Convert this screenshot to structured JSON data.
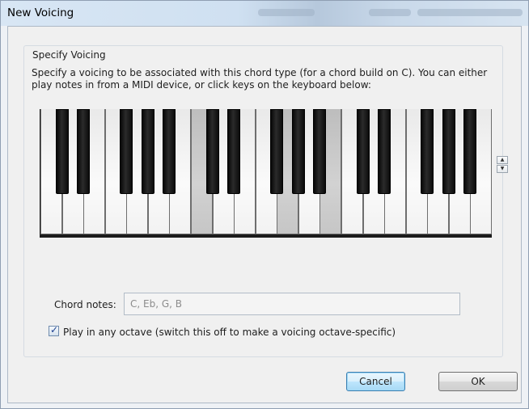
{
  "window": {
    "title": "New Voicing"
  },
  "group": {
    "label": "Specify Voicing",
    "description": "Specify a voicing to be associated with this chord type (for a chord build on C). You can either play notes in from a MIDI device, or click keys on the keyboard below:"
  },
  "keyboard": {
    "white_keys": 21,
    "selected_white_key_indices": [
      7,
      11,
      13
    ],
    "black_key_slots": [
      0,
      1,
      3,
      4,
      5,
      7,
      8,
      10,
      11,
      12,
      14,
      15,
      17,
      18,
      19
    ],
    "selected_black_key_slots": []
  },
  "chord_notes": {
    "label": "Chord notes:",
    "value": "C, Eb, G, B"
  },
  "play_any_octave": {
    "checked": true,
    "label": "Play in any octave (switch this off to make a voicing octave-specific)"
  },
  "buttons": {
    "cancel": "Cancel",
    "ok": "OK"
  },
  "icons": {
    "spin_up": "spin-up-icon",
    "spin_down": "spin-down-icon",
    "check": "checkmark-icon"
  }
}
